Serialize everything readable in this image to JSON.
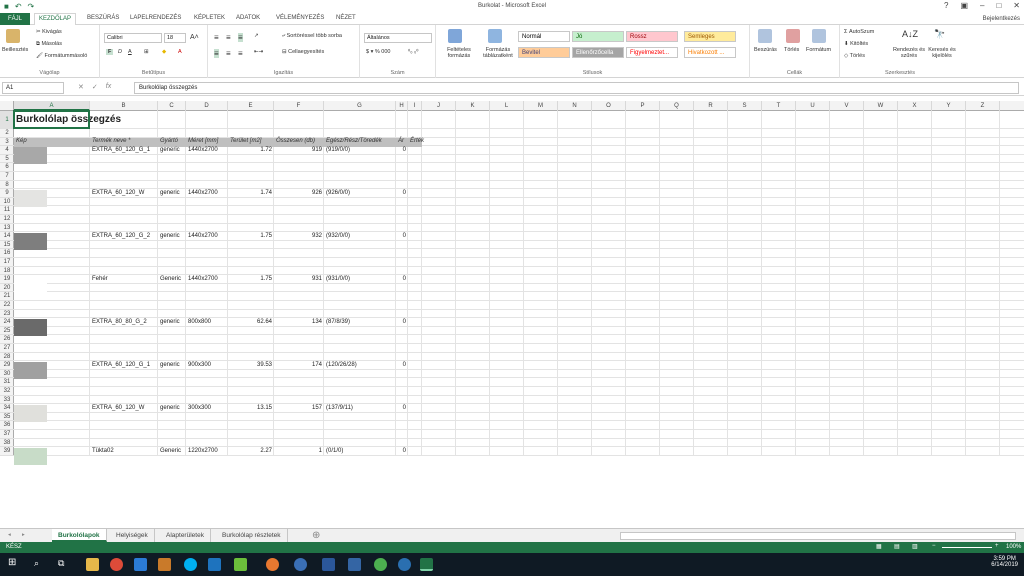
{
  "window": {
    "title": "Burkolat - Microsoft Excel",
    "signin": "Bejelentkezés"
  },
  "tabs": [
    "FÁJL",
    "KEZDŐLAP",
    "BESZÚRÁS",
    "LAPELRENDEZÉS",
    "KÉPLETEK",
    "ADATOK",
    "VÉLEMÉNYEZÉS",
    "NÉZET"
  ],
  "ribbon": {
    "clipboard": {
      "paste": "Beillesztés",
      "cut": "Kivágás",
      "copy": "Másolás",
      "painter": "Formátummásoló",
      "label": "Vágólap"
    },
    "font": {
      "name": "Calibri",
      "size": "18",
      "label": "Betűtípus"
    },
    "align": {
      "wrap": "Sortöréssel több sorba",
      "merge": "Cellaegyesítés",
      "label": "Igazítás"
    },
    "number": {
      "format": "Általános",
      "label": "Szám"
    },
    "styles": {
      "cond": "Feltételes formázás",
      "table": "Formázás táblázatként",
      "items": [
        {
          "label": "Normál",
          "bg": "#ffffff",
          "fg": "#000000"
        },
        {
          "label": "Jó",
          "bg": "#c6efce",
          "fg": "#006100"
        },
        {
          "label": "Rossz",
          "bg": "#ffc7ce",
          "fg": "#9c0006"
        },
        {
          "label": "Semleges",
          "bg": "#ffeb9c",
          "fg": "#9c5700"
        },
        {
          "label": "Bevitel",
          "bg": "#ffcc99",
          "fg": "#3f3f76"
        },
        {
          "label": "Ellenőrzőcella",
          "bg": "#a5a5a5",
          "fg": "#ffffff"
        },
        {
          "label": "Figyelmeztet...",
          "bg": "#ffffff",
          "fg": "#ff0000"
        },
        {
          "label": "Hivatkozott ...",
          "bg": "#ffffff",
          "fg": "#fa7d00"
        }
      ],
      "label": "Stílusok"
    },
    "cells": {
      "insert": "Beszúrás",
      "delete": "Törlés",
      "format": "Formátum",
      "label": "Cellák"
    },
    "editing": {
      "autosum": "AutoSzum",
      "fill": "Kitöltés",
      "clear": "Törlés",
      "sort": "Rendezés és szűrés",
      "find": "Keresés és kijelölés",
      "label": "Szerkesztés"
    }
  },
  "formula_bar": {
    "namebox": "A1",
    "fx": "fx",
    "content": "Burkolólap összegzés"
  },
  "columns": [
    "A",
    "B",
    "C",
    "D",
    "E",
    "F",
    "G",
    "H",
    "I",
    "J",
    "K",
    "L",
    "M",
    "N",
    "O",
    "P",
    "Q",
    "R",
    "S",
    "T",
    "U",
    "V",
    "W",
    "X",
    "Y",
    "Z"
  ],
  "row_numbers": [
    "1",
    "2",
    "3",
    "4",
    "5",
    "6",
    "7",
    "8",
    "9",
    "10",
    "11",
    "12",
    "13",
    "14",
    "15",
    "16",
    "17",
    "18",
    "19",
    "20",
    "21",
    "22",
    "23",
    "24",
    "25",
    "26",
    "27",
    "28",
    "29",
    "30",
    "31",
    "32",
    "33",
    "34",
    "35",
    "36",
    "37",
    "38",
    "39"
  ],
  "sheet": {
    "title": "Burkolólap összegzés",
    "headers": [
      "Kép",
      "Termék neve *",
      "Gyártó",
      "Méret [mm]",
      "Terület [m2]",
      "Összesen (db)",
      "Egész/Rész/Töredék",
      "Ár",
      "Érték"
    ],
    "rows": [
      {
        "name": "EXTRA_60_120_G_1",
        "maker": "generic",
        "size": "1440x2700",
        "area": "1.72",
        "total": "919",
        "parts": "(919/0/0)",
        "value": "0",
        "thumb": "#a8a8a8"
      },
      {
        "name": "EXTRA_60_120_W",
        "maker": "generic",
        "size": "1440x2700",
        "area": "1.74",
        "total": "926",
        "parts": "(926/0/0)",
        "value": "0",
        "thumb": "#e4e4e2"
      },
      {
        "name": "EXTRA_60_120_G_2",
        "maker": "generic",
        "size": "1440x2700",
        "area": "1.75",
        "total": "932",
        "parts": "(932/0/0)",
        "value": "0",
        "thumb": "#7e7e7e"
      },
      {
        "name": "Fehér",
        "maker": "Generic",
        "size": "1440x2700",
        "area": "1.75",
        "total": "931",
        "parts": "(931/0/0)",
        "value": "0",
        "thumb": "#ffffff"
      },
      {
        "name": "EXTRA_80_80_G_2",
        "maker": "generic",
        "size": "800x800",
        "area": "62.64",
        "total": "134",
        "parts": "(87/8/39)",
        "value": "0",
        "thumb": "#6a6a6a"
      },
      {
        "name": "EXTRA_60_120_G_1",
        "maker": "generic",
        "size": "900x300",
        "area": "39.53",
        "total": "174",
        "parts": "(120/26/28)",
        "value": "0",
        "thumb": "#a0a0a0"
      },
      {
        "name": "EXTRA_60_120_W",
        "maker": "generic",
        "size": "300x300",
        "area": "13.15",
        "total": "157",
        "parts": "(137/9/11)",
        "value": "0",
        "thumb": "#e0e0dc"
      },
      {
        "name": "Tükta02",
        "maker": "Generic",
        "size": "1220x2700",
        "area": "2.27",
        "total": "1",
        "parts": "(0/1/0)",
        "value": "0",
        "thumb": "#c8dcc8"
      }
    ]
  },
  "sheet_tabs": [
    "Burkolólapok",
    "Helyiségek",
    "Alapterületek",
    "Burkolólap részletek"
  ],
  "status": {
    "ready": "KÉSZ",
    "zoom": "100%"
  },
  "taskbar": {
    "time": "3:59 PM",
    "date": "6/14/2019"
  }
}
